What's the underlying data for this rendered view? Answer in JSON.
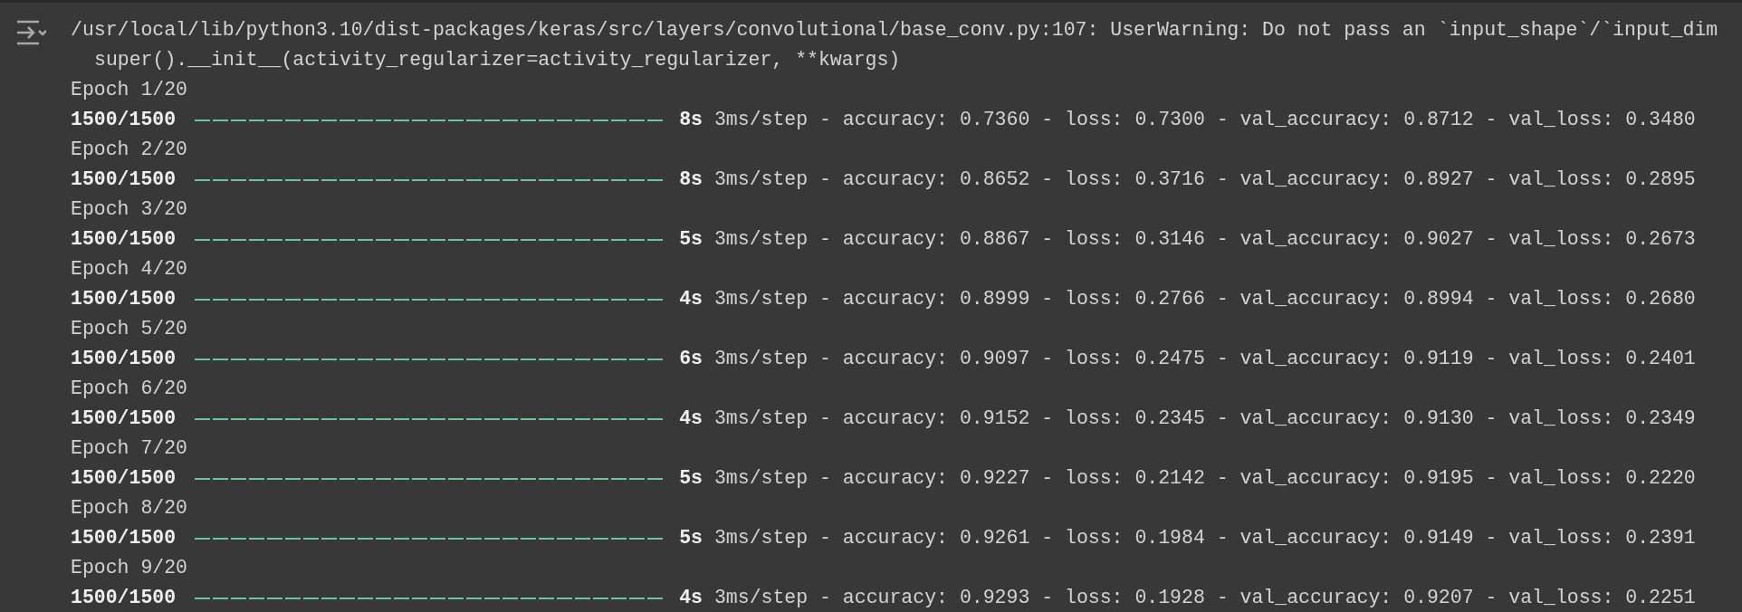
{
  "warning": {
    "message": "/usr/local/lib/python3.10/dist-packages/keras/src/layers/convolutional/base_conv.py:107: UserWarning: Do not pass an `input_shape`/`input_dim",
    "code": "super().__init__(activity_regularizer=activity_regularizer, **kwargs)"
  },
  "epochs": [
    {
      "label": "Epoch 1/20",
      "steps": "1500/1500",
      "progress": {
        "level": 1
      },
      "time": "8s",
      "stats": "3ms/step - accuracy: 0.7360 - loss: 0.7300 - val_accuracy: 0.8712 - val_loss: 0.3480"
    },
    {
      "label": "Epoch 2/20",
      "steps": "1500/1500",
      "progress": {
        "level": 1
      },
      "time": "8s",
      "stats": "3ms/step - accuracy: 0.8652 - loss: 0.3716 - val_accuracy: 0.8927 - val_loss: 0.2895"
    },
    {
      "label": "Epoch 3/20",
      "steps": "1500/1500",
      "progress": {
        "level": 1
      },
      "time": "5s",
      "stats": "3ms/step - accuracy: 0.8867 - loss: 0.3146 - val_accuracy: 0.9027 - val_loss: 0.2673"
    },
    {
      "label": "Epoch 4/20",
      "steps": "1500/1500",
      "progress": {
        "level": 1
      },
      "time": "4s",
      "stats": "3ms/step - accuracy: 0.8999 - loss: 0.2766 - val_accuracy: 0.8994 - val_loss: 0.2680"
    },
    {
      "label": "Epoch 5/20",
      "steps": "1500/1500",
      "progress": {
        "level": 1
      },
      "time": "6s",
      "stats": "3ms/step - accuracy: 0.9097 - loss: 0.2475 - val_accuracy: 0.9119 - val_loss: 0.2401"
    },
    {
      "label": "Epoch 6/20",
      "steps": "1500/1500",
      "progress": {
        "level": 1
      },
      "time": "4s",
      "stats": "3ms/step - accuracy: 0.9152 - loss: 0.2345 - val_accuracy: 0.9130 - val_loss: 0.2349"
    },
    {
      "label": "Epoch 7/20",
      "steps": "1500/1500",
      "progress": {
        "level": 1
      },
      "time": "5s",
      "stats": "3ms/step - accuracy: 0.9227 - loss: 0.2142 - val_accuracy: 0.9195 - val_loss: 0.2220"
    },
    {
      "label": "Epoch 8/20",
      "steps": "1500/1500",
      "progress": {
        "level": 1
      },
      "time": "5s",
      "stats": "3ms/step - accuracy: 0.9261 - loss: 0.1984 - val_accuracy: 0.9149 - val_loss: 0.2391"
    },
    {
      "label": "Epoch 9/20",
      "steps": "1500/1500",
      "progress": {
        "level": 1
      },
      "time": "4s",
      "stats": "3ms/step - accuracy: 0.9293 - loss: 0.1928 - val_accuracy: 0.9207 - val_loss: 0.2251"
    }
  ]
}
